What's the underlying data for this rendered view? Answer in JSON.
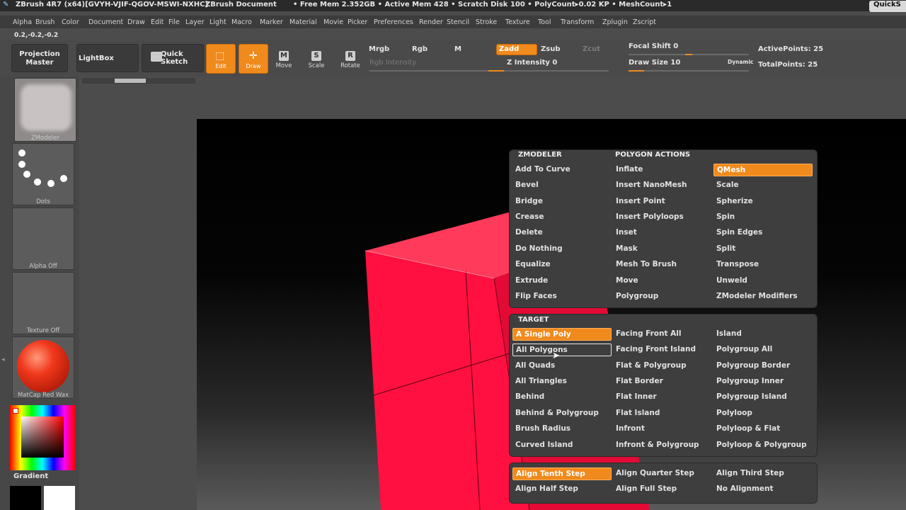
{
  "titlebar": {
    "app": "ZBrush 4R7 (x64)[GVYH-VJIF-QGOV-MSWI-NXHC]",
    "document": "ZBrush Document",
    "stats": "• Free Mem 2.352GB • Active Mem 428 • Scratch Disk 100 • PolyCount▸0.02 KP • MeshCount▸1",
    "quick": "QuickS"
  },
  "menu": [
    "Alpha",
    "Brush",
    "Color",
    "Document",
    "Draw",
    "Edit",
    "File",
    "Layer",
    "Light",
    "Macro",
    "Marker",
    "Material",
    "Movie",
    "Picker",
    "Preferences",
    "Render",
    "Stencil",
    "Stroke",
    "Texture",
    "Tool",
    "Transform",
    "Zplugin",
    "Zscript"
  ],
  "coords": "0.2,-0.2,-0.2",
  "toolbar": {
    "projection_master": "Projection Master",
    "lightbox": "LightBox",
    "quick_sketch": "Quick Sketch",
    "edit": "Edit",
    "draw": "Draw",
    "move": "Move",
    "scale": "Scale",
    "rotate": "Rotate",
    "mrgb": "Mrgb",
    "rgb": "Rgb",
    "m": "M",
    "zadd": "Zadd",
    "zsub": "Zsub",
    "zcut": "Zcut",
    "rgb_intensity": "Rgb Intensity",
    "z_intensity": "Z Intensity 0",
    "focal_shift": "Focal Shift 0",
    "draw_size": "Draw Size 10",
    "dynamic": "Dynamic",
    "active_points": "ActivePoints: 25",
    "total_points": "TotalPoints: 25"
  },
  "left": {
    "zmodeler": "ZModeler",
    "dots": "Dots",
    "alpha": "Alpha Off",
    "texture": "Texture Off",
    "matcap": "MatCap Red Wax",
    "gradient": "Gradient"
  },
  "zmodeler_panel": {
    "title_left": "ZMODELER",
    "title_right": "POLYGON ACTIONS",
    "col1": [
      "Add To Curve",
      "Bevel",
      "Bridge",
      "Crease",
      "Delete",
      "Do Nothing",
      "Equalize",
      "Extrude",
      "Flip Faces"
    ],
    "col2": [
      "Inflate",
      "Insert NanoMesh",
      "Insert Point",
      "Insert Polyloops",
      "Inset",
      "Mask",
      "Mesh To Brush",
      "Move",
      "Polygroup"
    ],
    "col3": [
      "QMesh",
      "Scale",
      "Spherize",
      "Spin",
      "Spin Edges",
      "Split",
      "Transpose",
      "Unweld",
      "ZModeler Modifiers"
    ]
  },
  "target_panel": {
    "title": "TARGET",
    "col1": [
      "A Single Poly",
      "All Polygons",
      "All Quads",
      "All Triangles",
      "Behind",
      "Behind & Polygroup",
      "Brush Radius",
      "Curved Island"
    ],
    "col2": [
      "Facing Front All",
      "Facing Front Island",
      "Flat & Polygroup",
      "Flat Border",
      "Flat Inner",
      "Flat Island",
      "Infront",
      "Infront & Polygroup"
    ],
    "col3": [
      "Island",
      "Polygroup All",
      "Polygroup Border",
      "Polygroup Inner",
      "Polygroup Island",
      "Polyloop",
      "Polyloop & Flat",
      "Polyloop & Polygroup"
    ]
  },
  "align_panel": {
    "row1": [
      "Align Tenth Step",
      "Align Quarter Step",
      "Align Third Step"
    ],
    "row2": [
      "Align Half Step",
      "Align Full Step",
      "No Alignment"
    ]
  },
  "colors": {
    "accent": "#f08a1c",
    "mesh": "#f0123a"
  }
}
